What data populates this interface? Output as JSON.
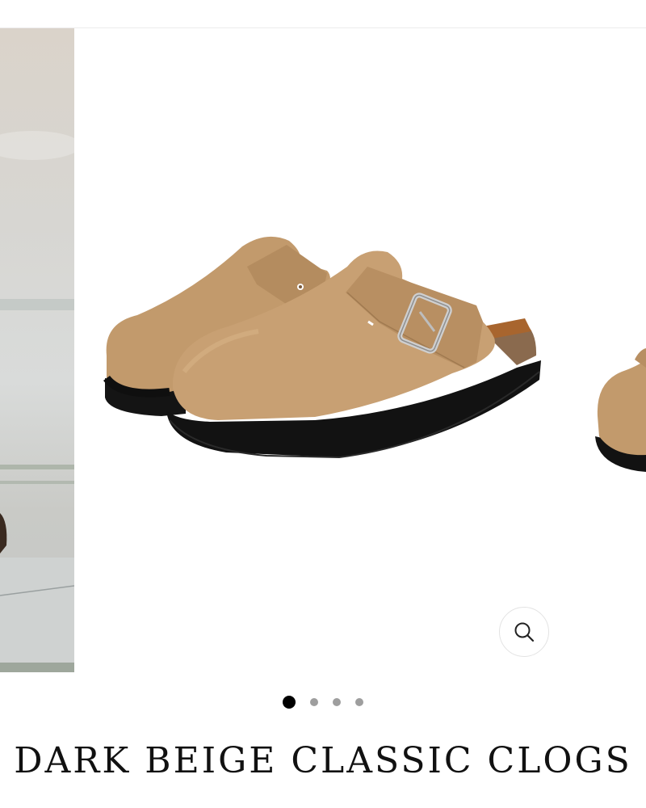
{
  "product": {
    "title": "DARK BEIGE CLASSIC CLOGS"
  },
  "gallery": {
    "slide_count": 4,
    "active_index": 0,
    "slides": [
      "lifestyle-photo",
      "product-photo-main",
      "product-photo-next",
      "product-photo-4"
    ]
  },
  "zoom": {
    "icon": "magnifier-icon"
  },
  "colors": {
    "suede": "#c29a6c",
    "sole": "#111111",
    "cork": "#8a6a4e",
    "dot_active": "#000000",
    "dot_inactive": "#9e9e9e"
  }
}
